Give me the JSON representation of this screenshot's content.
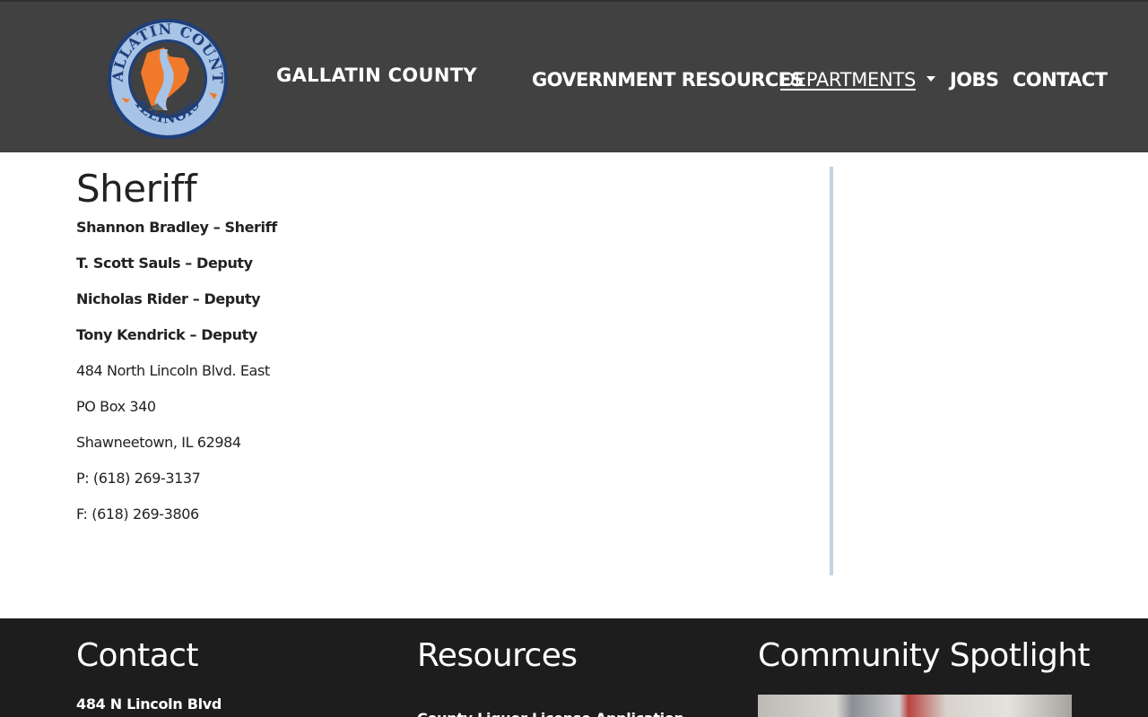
{
  "header": {
    "logo_text_top": "GALLATIN COUNTY",
    "logo_text_bottom": "ILLINOIS",
    "site_title": "GALLATIN COUNTY",
    "nav": [
      {
        "label": "GOVERNMENT RESOURCES"
      },
      {
        "label": "DEPARTMENTS",
        "has_dropdown": true
      },
      {
        "label": "JOBS"
      },
      {
        "label": "CONTACT"
      }
    ]
  },
  "main": {
    "title": "Sheriff",
    "lines": [
      {
        "text": "Shannon Bradley – Sheriff",
        "bold": true
      },
      {
        "text": "T. Scott Sauls – Deputy",
        "bold": true
      },
      {
        "text": "Nicholas Rider – Deputy",
        "bold": true
      },
      {
        "text": "Tony Kendrick – Deputy",
        "bold": true
      },
      {
        "text": "484 North Lincoln Blvd. East",
        "bold": false
      },
      {
        "text": "PO Box 340",
        "bold": false
      },
      {
        "text": "Shawneetown, IL 62984",
        "bold": false
      },
      {
        "text": "P: (618) 269-3137",
        "bold": false
      },
      {
        "text": "F: (618) 269-3806",
        "bold": false
      }
    ]
  },
  "footer": {
    "contact_heading": "Contact",
    "contact_line": "484 N Lincoln Blvd",
    "resources_heading": "Resources",
    "resources_link": "County Liquor License Application",
    "spotlight_heading": "Community Spotlight"
  },
  "colors": {
    "header_bg": "#414141",
    "footer_bg": "#1d1d1d",
    "sidebar_rule": "#c3d3e3",
    "logo_orange": "#f07a2a",
    "logo_blue": "#a7c4e6"
  }
}
